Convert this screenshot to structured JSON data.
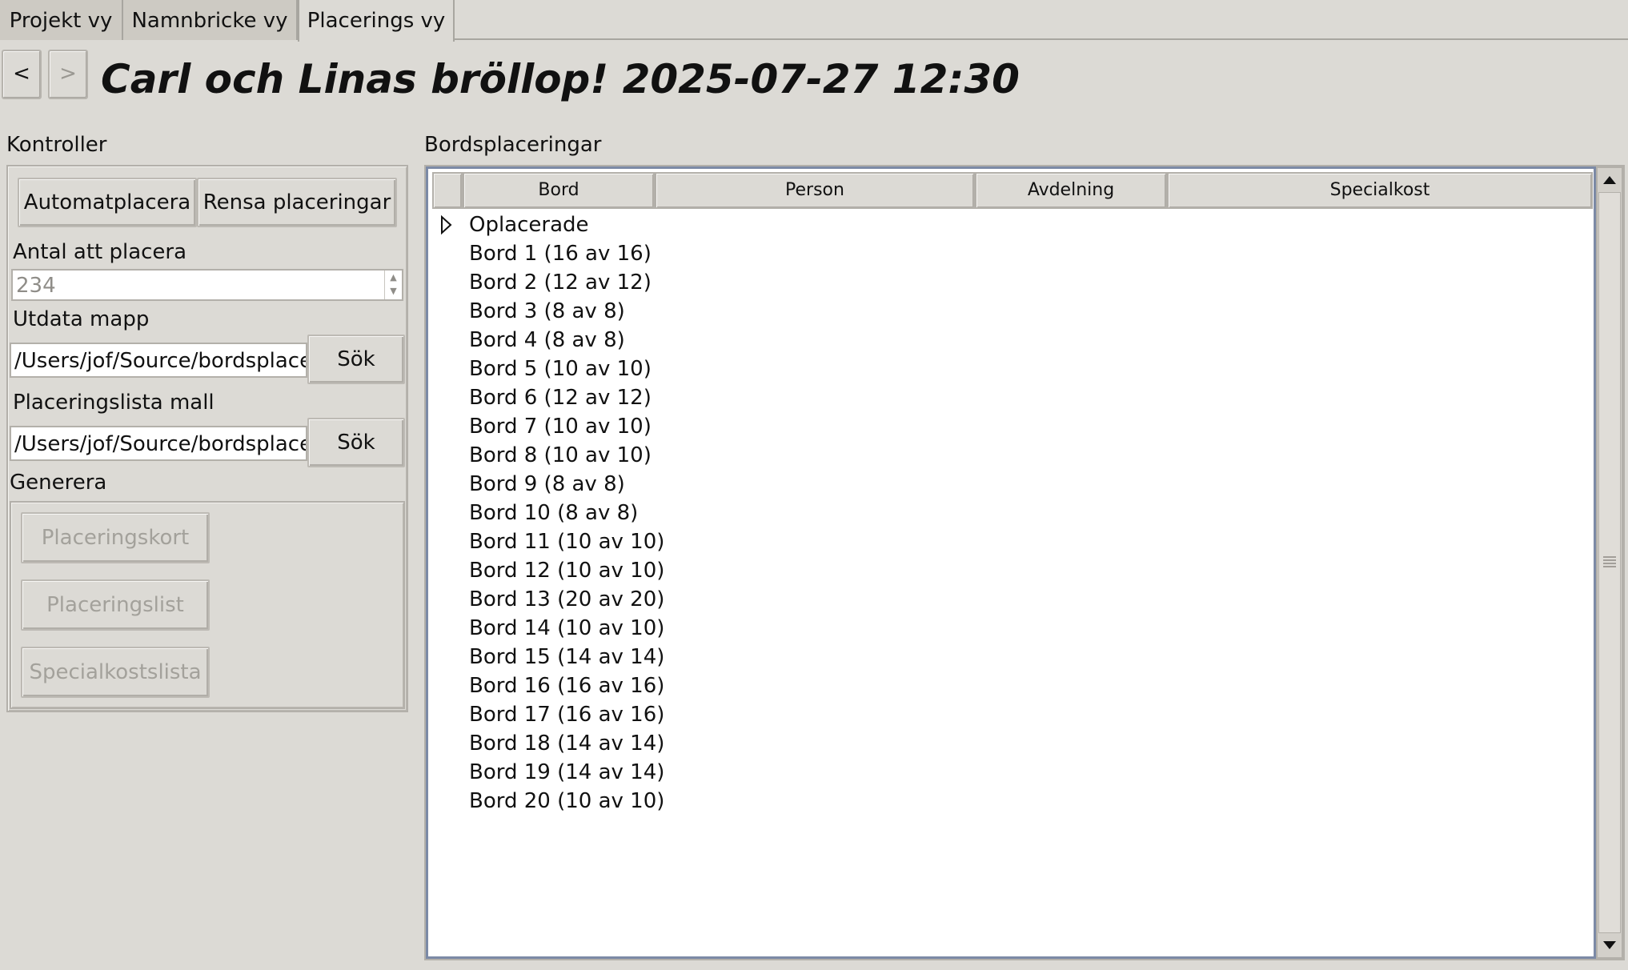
{
  "tabs": [
    "Projekt vy",
    "Namnbricke vy",
    "Placerings vy"
  ],
  "nav": {
    "back": "<",
    "forward": ">"
  },
  "title": "Carl och Linas bröllop! 2025-07-27 12:30",
  "controls": {
    "heading": "Kontroller",
    "auto_place": "Automatplacera",
    "clear_placements": "Rensa placeringar",
    "count_label": "Antal att placera",
    "count_value": "234",
    "output_label": "Utdata mapp",
    "output_value": "/Users/jof/Source/bordsplacer",
    "output_browse": "Sök",
    "template_label": "Placeringslista mall",
    "template_value": "/Users/jof/Source/bordsplacer",
    "template_browse": "Sök",
    "generate_label": "Generera",
    "gen_cards": "Placeringskort",
    "gen_list": "Placeringslist",
    "gen_diet": "Specialkostslista"
  },
  "placements": {
    "heading": "Bordsplaceringar",
    "columns": [
      "Bord",
      "Person",
      "Avdelning",
      "Specialkost"
    ],
    "rows": [
      "Oplacerade",
      "Bord 1 (16 av 16)",
      "Bord 2 (12 av 12)",
      "Bord 3 (8 av 8)",
      "Bord 4 (8 av 8)",
      "Bord 5 (10 av 10)",
      "Bord 6 (12 av 12)",
      "Bord 7 (10 av 10)",
      "Bord 8 (10 av 10)",
      "Bord 9 (8 av 8)",
      "Bord 10 (8 av 8)",
      "Bord 11 (10 av 10)",
      "Bord 12 (10 av 10)",
      "Bord 13 (20 av 20)",
      "Bord 14 (10 av 10)",
      "Bord 15 (14 av 14)",
      "Bord 16 (16 av 16)",
      "Bord 17 (16 av 16)",
      "Bord 18 (14 av 14)",
      "Bord 19 (14 av 14)",
      "Bord 20 (10 av 10)"
    ]
  }
}
